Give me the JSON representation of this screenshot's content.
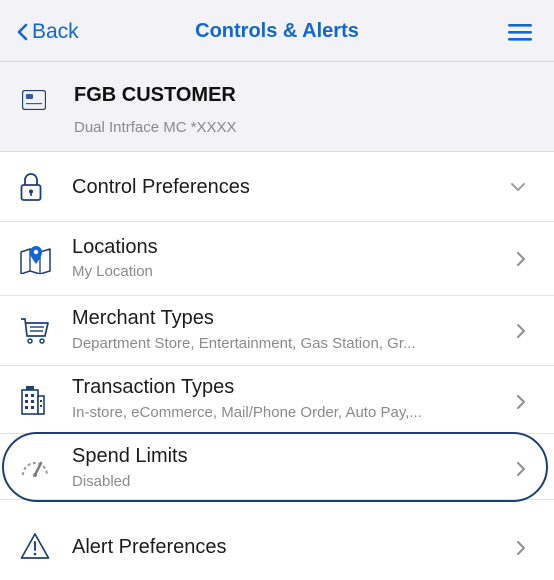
{
  "nav": {
    "back_label": "Back",
    "title": "Controls & Alerts",
    "back_icon": "chevron-left-icon",
    "menu_icon": "hamburger-menu-icon"
  },
  "card": {
    "name": "FGB CUSTOMER",
    "description": "Dual Intrface MC *XXXX",
    "icon": "credit-card-icon"
  },
  "rows": [
    {
      "title": "Control Preferences",
      "subtitle": "",
      "icon": "lock-icon",
      "chevron": "chevron-down-icon"
    },
    {
      "title": "Locations",
      "subtitle": "My Location",
      "icon": "map-pin-icon",
      "chevron": "chevron-right-icon"
    },
    {
      "title": "Merchant Types",
      "subtitle": "Department Store, Entertainment, Gas Station, Gr...",
      "icon": "shopping-cart-icon",
      "chevron": "chevron-right-icon"
    },
    {
      "title": "Transaction Types",
      "subtitle": "In-store, eCommerce, Mail/Phone Order, Auto Pay,...",
      "icon": "building-icon",
      "chevron": "chevron-right-icon"
    },
    {
      "title": "Spend Limits",
      "subtitle": "Disabled",
      "icon": "gauge-icon",
      "chevron": "chevron-right-icon"
    },
    {
      "title": "Alert Preferences",
      "subtitle": "",
      "icon": "warning-triangle-icon",
      "chevron": "chevron-right-icon"
    }
  ],
  "colors": {
    "accent": "#1366d6",
    "highlight_ring": "#1b3f7a",
    "header_bg": "#f2f2f7"
  }
}
